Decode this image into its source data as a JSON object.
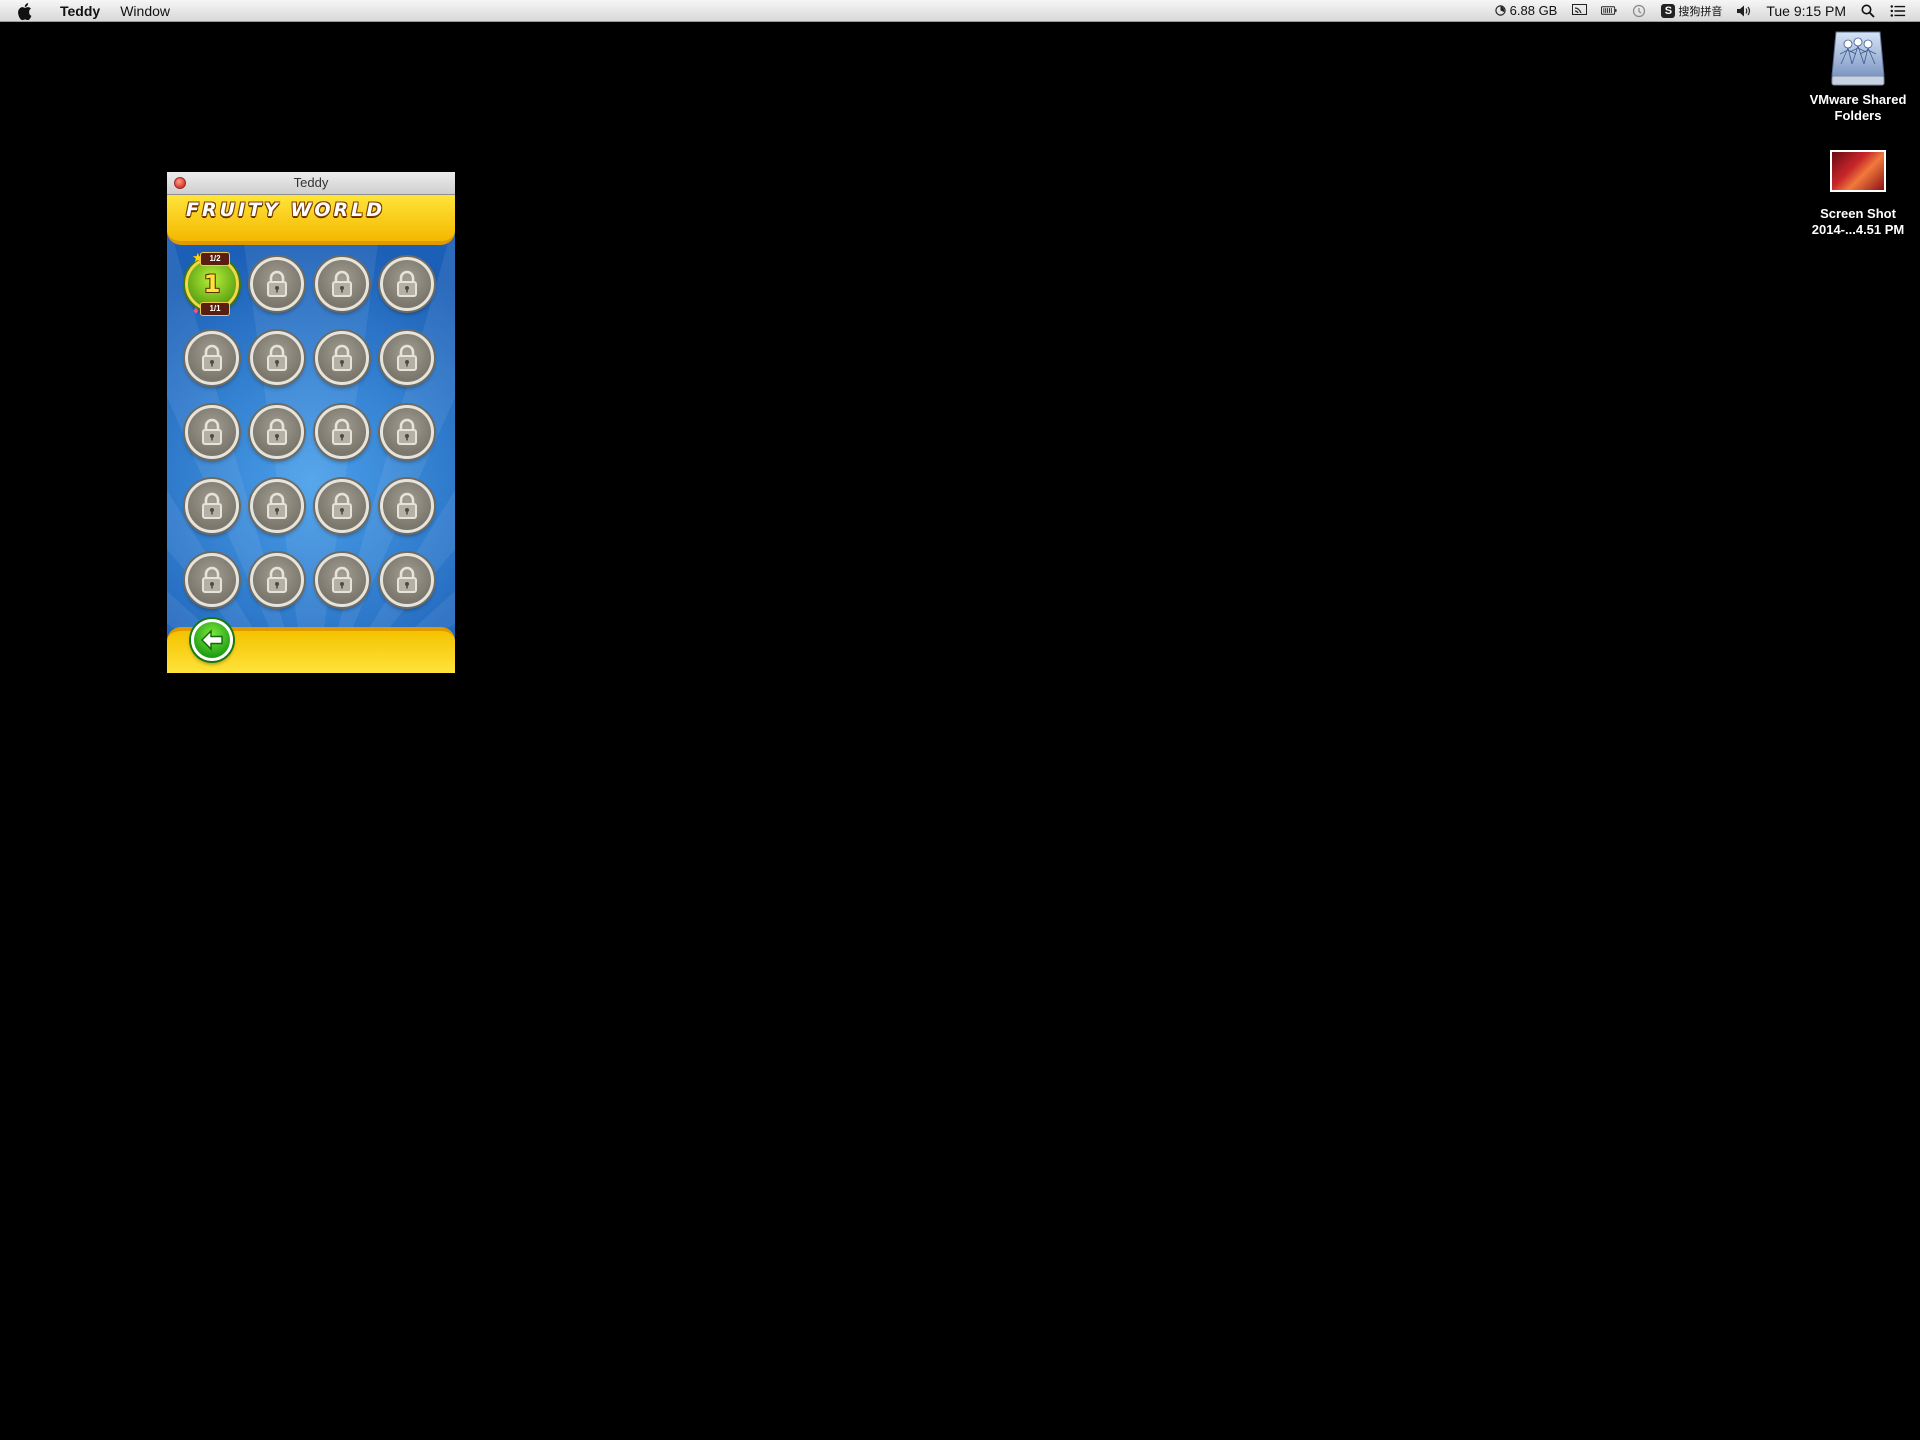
{
  "menubar": {
    "app_name": "Teddy",
    "menus": [
      "Window"
    ],
    "memory": "6.88 GB",
    "ime_label": "搜狗拼音",
    "ime_badge": "S",
    "clock": "Tue 9:15 PM"
  },
  "desktop": {
    "icons": [
      {
        "label": "VMware Shared Folders",
        "icon": "network-drive-icon"
      },
      {
        "label": "Screen Shot 2014-...4.51 PM",
        "icon": "image-thumbnail-icon"
      }
    ]
  },
  "window": {
    "title": "Teddy",
    "world_title": "FRUITY WORLD",
    "levels": [
      {
        "number": "1",
        "locked": false,
        "stars": "1/2",
        "gems": "1/1"
      },
      {
        "locked": true
      },
      {
        "locked": true
      },
      {
        "locked": true
      },
      {
        "locked": true
      },
      {
        "locked": true
      },
      {
        "locked": true
      },
      {
        "locked": true
      },
      {
        "locked": true
      },
      {
        "locked": true
      },
      {
        "locked": true
      },
      {
        "locked": true
      },
      {
        "locked": true
      },
      {
        "locked": true
      },
      {
        "locked": true
      },
      {
        "locked": true
      },
      {
        "locked": true
      },
      {
        "locked": true
      },
      {
        "locked": true
      },
      {
        "locked": true
      }
    ],
    "back_icon": "back-arrow-icon"
  },
  "colors": {
    "desktop": "#000000",
    "game_blue": "#1e63b8",
    "band_yellow": "#ffe43a",
    "unlocked_green": "#5aa012",
    "back_green": "#1e9e14"
  }
}
